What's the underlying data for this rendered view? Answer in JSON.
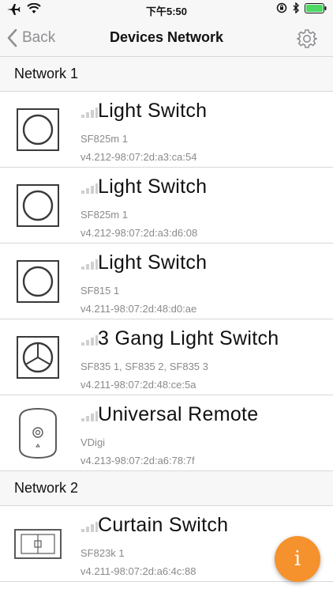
{
  "status_bar": {
    "time": "下午5:50"
  },
  "nav": {
    "back_label": "Back",
    "title": "Devices Network"
  },
  "sections": [
    {
      "title": "Network 1",
      "devices": [
        {
          "name": "Light Switch",
          "model": "SF825m 1",
          "address": "v4.212-98:07:2d:a3:ca:54",
          "icon": "switch-1-gang-icon"
        },
        {
          "name": "Light Switch",
          "model": "SF825m 1",
          "address": "v4.212-98:07:2d:a3:d6:08",
          "icon": "switch-1-gang-icon"
        },
        {
          "name": "Light Switch",
          "model": "SF815 1",
          "address": "v4.211-98:07:2d:48:d0:ae",
          "icon": "switch-1-gang-icon"
        },
        {
          "name": "3 Gang Light Switch",
          "model": "SF835 1, SF835 2, SF835 3",
          "address": "v4.211-98:07:2d:48:ce:5a",
          "icon": "switch-3-gang-icon"
        },
        {
          "name": "Universal Remote",
          "model": "VDigi",
          "address": "v4.213-98:07:2d:a6:78:7f",
          "icon": "remote-icon"
        }
      ]
    },
    {
      "title": "Network 2",
      "devices": [
        {
          "name": "Curtain Switch",
          "model": "SF823k 1",
          "address": "v4.211-98:07:2d:a6:4c:88",
          "icon": "curtain-switch-icon"
        }
      ]
    }
  ],
  "fab": {
    "label": "i"
  },
  "colors": {
    "accent": "#f5922d",
    "header_bg": "#f7f7f7",
    "secondary_text": "#8a8a8a"
  }
}
